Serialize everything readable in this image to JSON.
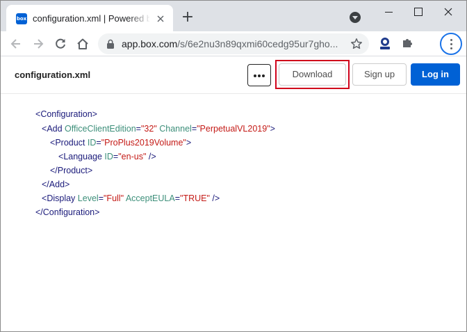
{
  "browser": {
    "tab_title": "configuration.xml | Powered by Box",
    "favicon_text": "box",
    "new_tab_symbol": "+",
    "url_host": "app.box.com",
    "url_path": "/s/6e2nu3n89qxmi60cedg95ur7gho..."
  },
  "header": {
    "file_name": "configuration.xml",
    "download_label": "Download",
    "signup_label": "Sign up",
    "login_label": "Log in"
  },
  "xml": {
    "line1": {
      "open": "<",
      "tag": "Configuration",
      "close": ">"
    },
    "line2": {
      "open": "<",
      "tag": "Add",
      "attr1": "OfficeClientEdition",
      "eq1": "=",
      "val1": "\"32\"",
      "attr2": "Channel",
      "eq2": "=",
      "val2": "\"PerpetualVL2019\"",
      "close": ">"
    },
    "line3": {
      "open": "<",
      "tag": "Product",
      "attr1": "ID",
      "eq1": "=",
      "val1": "\"ProPlus2019Volume\"",
      "close": ">"
    },
    "line4": {
      "open": "<",
      "tag": "Language",
      "attr1": "ID",
      "eq1": "=",
      "val1": "\"en-us\"",
      "close": " />"
    },
    "line5": {
      "open": "</",
      "tag": "Product",
      "close": ">"
    },
    "line6": {
      "open": "</",
      "tag": "Add",
      "close": ">"
    },
    "line7": {
      "open": "<",
      "tag": "Display",
      "attr1": "Level",
      "eq1": "=",
      "val1": "\"Full\"",
      "attr2": "AcceptEULA",
      "eq2": "=",
      "val2": "\"TRUE\"",
      "close": " />"
    },
    "line8": {
      "open": "</",
      "tag": "Configuration",
      "close": ">"
    }
  },
  "colors": {
    "box_blue": "#0061d5",
    "highlight_red": "#d0021b",
    "xml_tag": "#1a1a7a",
    "xml_attr": "#3d8f7a",
    "xml_value": "#c41a16"
  }
}
